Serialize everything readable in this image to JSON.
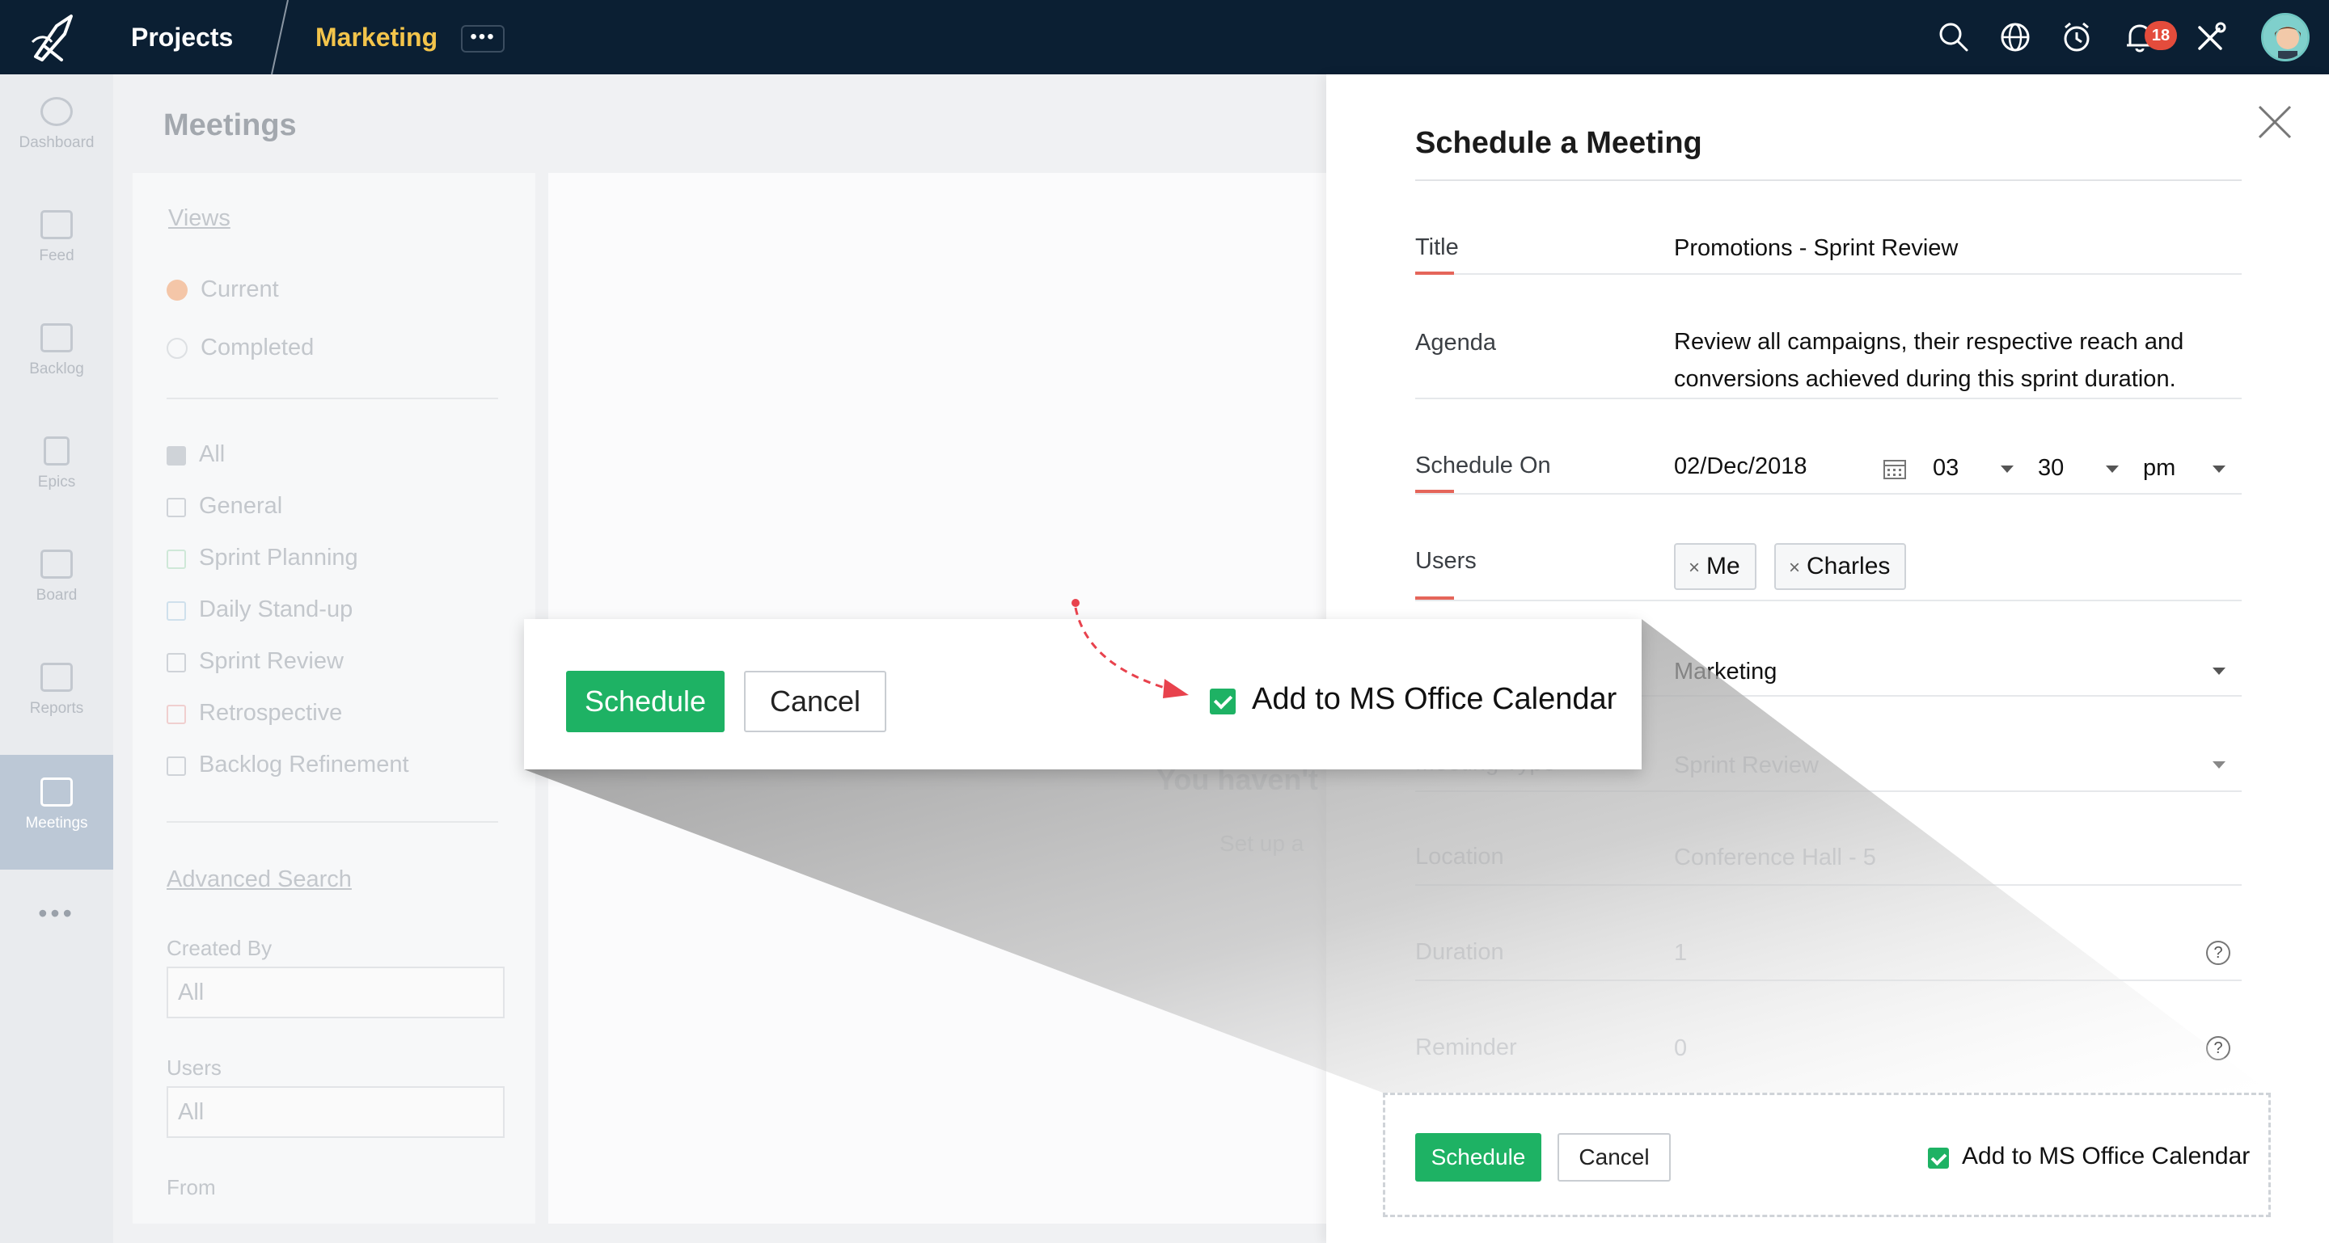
{
  "topbar": {
    "projects_label": "Projects",
    "project_name": "Marketing",
    "more_label": "•••",
    "notification_count": "18",
    "icons": [
      "search-icon",
      "globe-icon",
      "alarm-clock-icon",
      "bell-icon",
      "tools-icon",
      "avatar"
    ]
  },
  "leftnav": {
    "items": [
      {
        "label": "Dashboard",
        "icon": "dashboard-icon"
      },
      {
        "label": "Feed",
        "icon": "feed-icon"
      },
      {
        "label": "Backlog",
        "icon": "backlog-icon"
      },
      {
        "label": "Epics",
        "icon": "epics-icon"
      },
      {
        "label": "Board",
        "icon": "board-icon"
      },
      {
        "label": "Reports",
        "icon": "reports-icon"
      },
      {
        "label": "Meetings",
        "icon": "meetings-icon",
        "active": true
      }
    ],
    "more": "•••"
  },
  "background": {
    "page_title": "Meetings",
    "views_heading": "Views",
    "views": [
      "Current",
      "Completed"
    ],
    "types": [
      "All",
      "General",
      "Sprint Planning",
      "Daily Stand-up",
      "Sprint Review",
      "Retrospective",
      "Backlog Refinement"
    ],
    "advanced_search": "Advanced Search",
    "created_by_label": "Created By",
    "created_by_value": "All",
    "users_label": "Users",
    "users_value": "All",
    "from_label": "From",
    "empty_heading": "You haven't",
    "empty_sub": "Set up a"
  },
  "form": {
    "title": "Schedule a Meeting",
    "fields": {
      "title_label": "Title",
      "title_value": "Promotions - Sprint Review",
      "agenda_label": "Agenda",
      "agenda_line1": "Review all campaigns, their respective reach and",
      "agenda_line2": "conversions achieved during this sprint duration.",
      "schedule_label": "Schedule On",
      "date": "02/Dec/2018",
      "hour": "03",
      "minute": "30",
      "ampm": "pm",
      "users_label": "Users",
      "users": [
        "Me",
        "Charles"
      ],
      "project_value": "Marketing",
      "type_label": "Meeting Type",
      "type_value": "Sprint Review",
      "location_label": "Location",
      "location_value": "Conference Hall - 5",
      "duration_label": "Duration",
      "duration_value": "1",
      "reminder_label": "Reminder",
      "reminder_value": "0"
    },
    "schedule_button": "Schedule",
    "cancel_button": "Cancel",
    "calendar_checkbox_label": "Add to MS Office Calendar"
  },
  "colors": {
    "topbar": "#0b1f33",
    "accent_yellow": "#f3c44b",
    "primary_green": "#1eb264",
    "field_underline": "#e5655a",
    "badge_red": "#e44c3c"
  }
}
